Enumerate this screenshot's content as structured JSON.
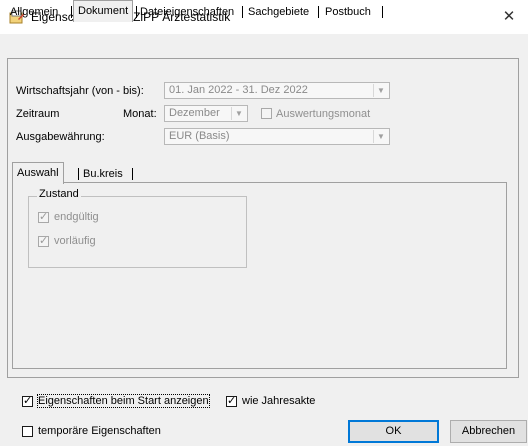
{
  "window": {
    "title": "Eigenschaften von ZiPP Ärztestatistik"
  },
  "tabs": [
    {
      "label": "Allgemein"
    },
    {
      "label": "Dokument"
    },
    {
      "label": "Dateieigenschaften"
    },
    {
      "label": "Sachgebiete"
    },
    {
      "label": "Postbuch"
    }
  ],
  "active_tab": "Dokument",
  "form": {
    "fiscal_year_label": "Wirtschaftsjahr (von - bis):",
    "fiscal_year_value": "01. Jan 2022  -  31. Dez 2022",
    "period_label": "Zeitraum",
    "month_label": "Monat:",
    "month_value": "Dezember",
    "evaluation_month_label": "Auswertungsmonat",
    "currency_label": "Ausgabewährung:",
    "currency_value": "EUR (Basis)"
  },
  "inner_tabs": [
    {
      "label": "Auswahl"
    },
    {
      "label": "Bu.kreis"
    }
  ],
  "status_group": {
    "title": "Zustand",
    "final_label": "endgültig",
    "final_checked": true,
    "provisional_label": "vorläufig",
    "provisional_checked": true
  },
  "options": {
    "show_on_start_label": "Eigenschaften beim Start anzeigen",
    "show_on_start_checked": true,
    "like_annual_label": "wie Jahresakte",
    "like_annual_checked": true,
    "temporary_label": "temporäre Eigenschaften",
    "temporary_checked": false
  },
  "buttons": {
    "ok": "OK",
    "cancel": "Abbrechen"
  },
  "colors": {
    "accent": "#0078d7",
    "disabled_text": "#8f8f8f",
    "background": "#f0f0f0"
  },
  "icons": {
    "title": "properties-icon",
    "close": "close-icon",
    "dropdown": "chevron-down-icon",
    "check": "checkmark-icon"
  }
}
